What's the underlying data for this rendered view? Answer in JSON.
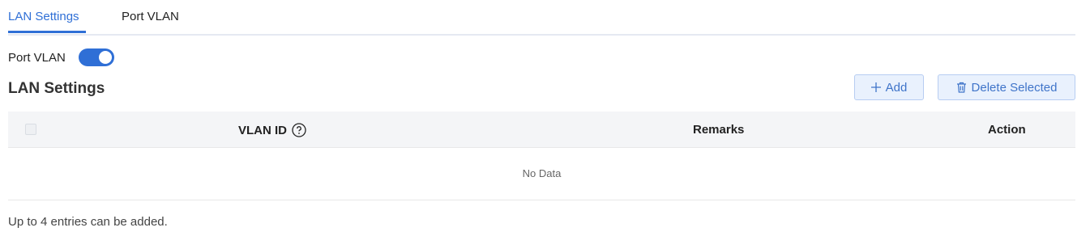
{
  "tabs": [
    {
      "label": "LAN Settings",
      "active": true
    },
    {
      "label": "Port VLAN",
      "active": false
    }
  ],
  "port_vlan_toggle": {
    "label": "Port VLAN",
    "on": true
  },
  "section": {
    "title": "LAN Settings"
  },
  "toolbar": {
    "add_label": "Add",
    "add_icon": "plus-icon",
    "delete_label": "Delete Selected",
    "delete_icon": "trash-icon"
  },
  "table": {
    "columns": [
      "VLAN ID",
      "Remarks",
      "Action"
    ],
    "vlan_help_icon": "question-circle-icon",
    "empty_text": "No Data",
    "rows": []
  },
  "footnote": "Up to 4 entries can be added.",
  "colors": {
    "accent": "#2f6fd6",
    "button_bg": "#e9f1fd",
    "header_bg": "#f4f5f7"
  }
}
